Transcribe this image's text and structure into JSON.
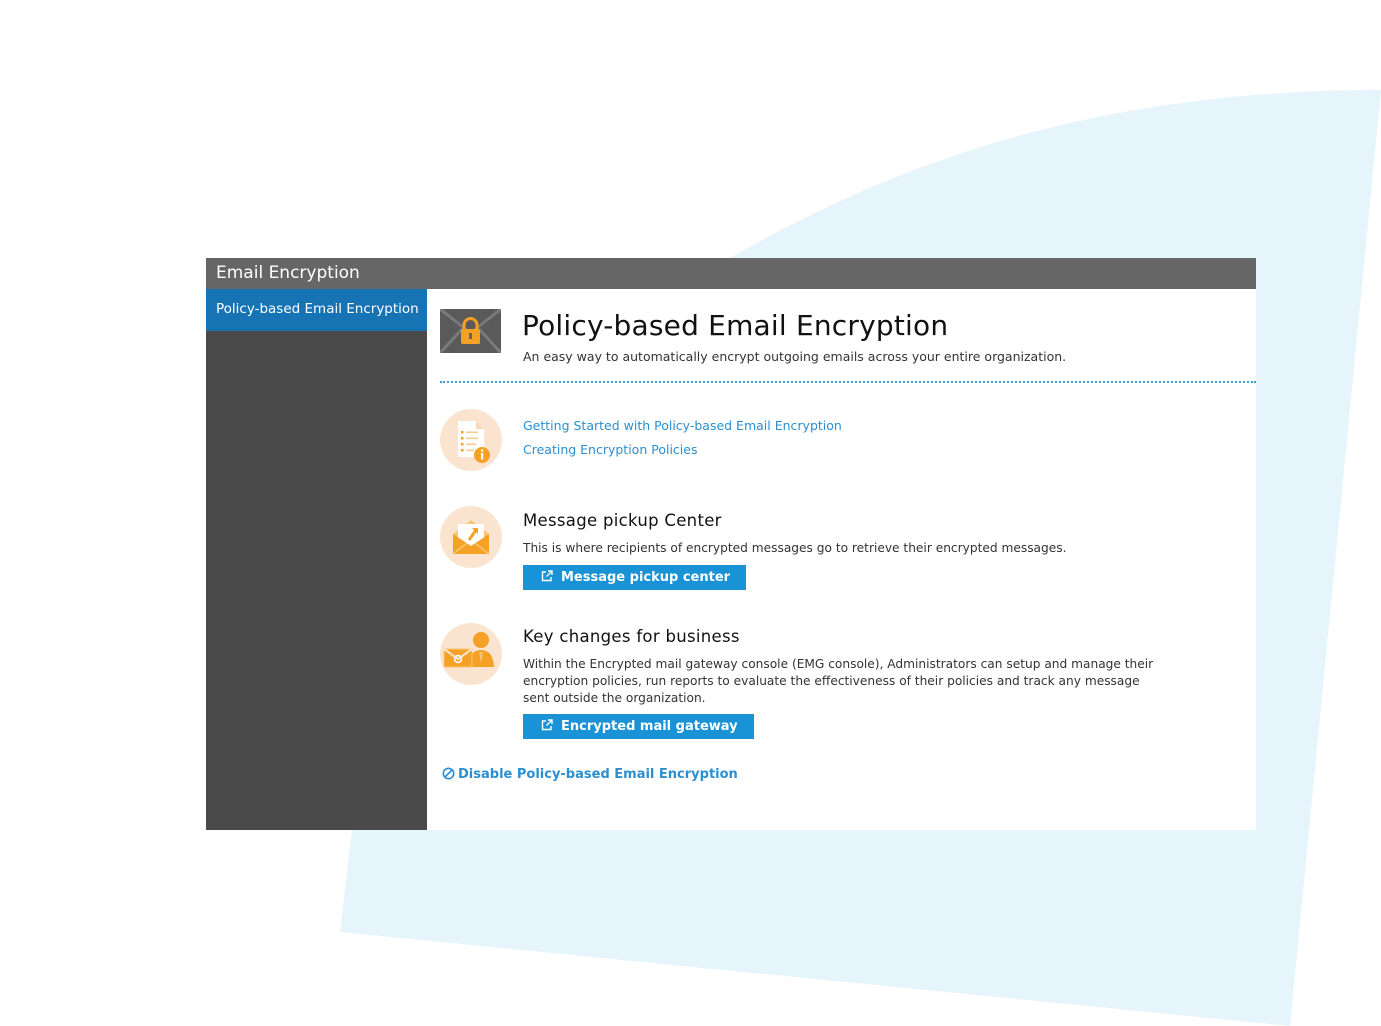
{
  "window": {
    "title": "Email Encryption"
  },
  "sidebar": {
    "items": [
      {
        "label": "Policy-based Email Encryption",
        "active": true
      }
    ]
  },
  "header": {
    "icon": "locked-envelope-icon",
    "title": "Policy-based Email Encryption",
    "subtitle": "An easy way to automatically encrypt outgoing emails across your entire organization."
  },
  "resources": {
    "icon": "document-info-icon",
    "links": [
      {
        "label": "Getting Started with Policy-based Email Encryption"
      },
      {
        "label": "Creating Encryption Policies"
      }
    ]
  },
  "pickup": {
    "icon": "open-envelope-icon",
    "title": "Message pickup Center",
    "description": "This is where recipients of encrypted messages go to retrieve their encrypted messages.",
    "button_label": "Message pickup center"
  },
  "business": {
    "icon": "user-envelope-icon",
    "title": "Key changes for business",
    "description": "Within the Encrypted mail gateway console (EMG console), Administrators can setup and manage their encryption policies, run reports to evaluate the effectiveness of their policies and track any message sent outside the organization.",
    "button_label": "Encrypted mail gateway"
  },
  "disable": {
    "icon": "disable-icon",
    "label": "Disable Policy-based Email Encryption"
  },
  "colors": {
    "titlebar": "#666666",
    "sidebar": "#4a4a4a",
    "sidebar_active": "#1674b4",
    "accent": "#1a92d6",
    "link": "#2b8fd0",
    "icon_circle": "#fbe4cf",
    "icon_orange": "#f4a125",
    "background_shape": "#e6f5fc"
  }
}
